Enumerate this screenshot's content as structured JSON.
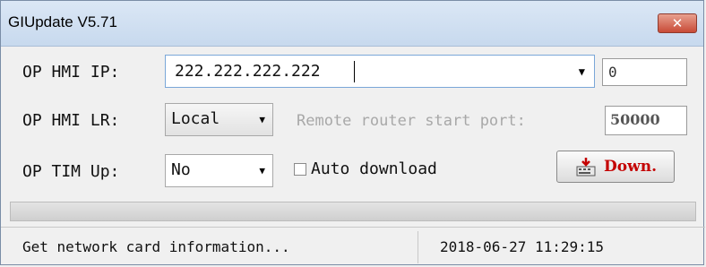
{
  "window": {
    "title": "GIUpdate V5.71",
    "close_glyph": "✕"
  },
  "form": {
    "ip_label": "OP HMI IP:",
    "ip_value": "222.222.222.222",
    "ip_port_value": "0",
    "lr_label": "OP HMI LR:",
    "lr_selected": "Local",
    "router_port_label": "Remote router start port:",
    "router_port_value": "50000",
    "tim_label": "OP TIM Up:",
    "tim_selected": "No",
    "auto_download_label": "Auto download",
    "auto_download_checked": false,
    "down_button_label": "Down."
  },
  "progress": {
    "value_percent": 0
  },
  "status": {
    "message": "Get network card information...",
    "datetime": "2018-06-27  11:29:15"
  },
  "colors": {
    "accent": "#c40000",
    "title_bg": "#c7d9ee",
    "close_bg": "#c84b37",
    "focus_border": "#7aa7d8"
  },
  "icons": {
    "close": "close-icon",
    "download": "download-icon",
    "dropdown": "chevron-down-icon"
  }
}
